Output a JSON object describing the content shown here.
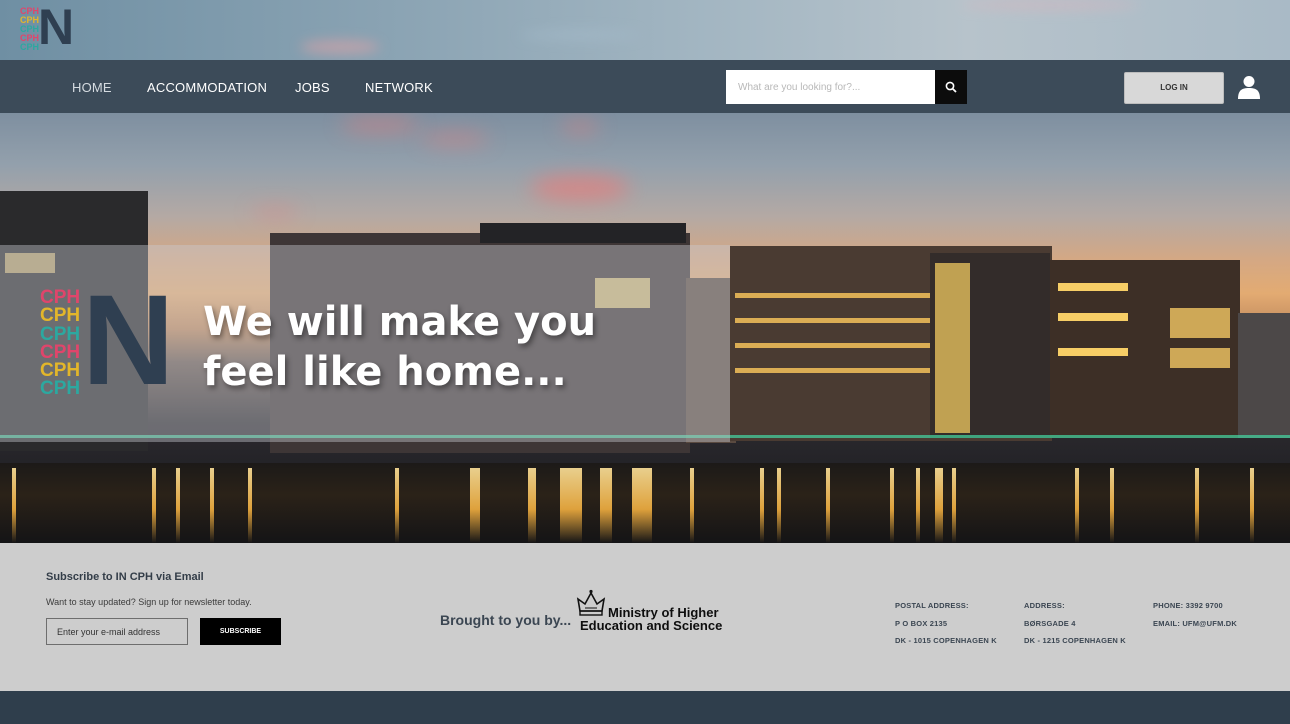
{
  "logo": {
    "stack_lines": [
      "CPH",
      "CPH",
      "CPH",
      "CPH",
      "CPH",
      "CPH"
    ],
    "stack_colors": [
      "#e0456b",
      "#e3b62a",
      "#2ca8a0",
      "#e0456b",
      "#e3b62a",
      "#2ca8a0"
    ],
    "letter": "N"
  },
  "nav": {
    "items": [
      {
        "label": "HOME"
      },
      {
        "label": "ACCOMMODATION"
      },
      {
        "label": "JOBS"
      },
      {
        "label": "NETWORK"
      }
    ],
    "search_placeholder": "What are you looking for?...",
    "login_label": "LOG IN"
  },
  "hero": {
    "line1": "We will make you",
    "line2": "feel like home..."
  },
  "footer": {
    "subscribe_title": "Subscribe to IN CPH via Email",
    "subscribe_desc": "Want to stay updated? Sign up for newsletter today.",
    "email_placeholder": "Enter your e-mail address",
    "subscribe_label": "SUBSCRIBE",
    "brought_by": "Brought to you by...",
    "ministry_line1": "Ministry of Higher",
    "ministry_line2": "Education and Science",
    "postal_label": "POSTAL ADDRESS:",
    "postal_line1": "P O BOX 2135",
    "postal_line2": "DK - 1015 COPENHAGEN K",
    "address_label": "ADDRESS:",
    "address_line1": "BØRSGADE 4",
    "address_line2": "DK - 1215 COPENHAGEN K",
    "phone": "PHONE: 3392 9700",
    "email": "EMAIL: UFM@UFM.DK"
  },
  "colors": {
    "nav_bg": "#3c4b59",
    "footer_bg": "#cdcdcd",
    "logo_n": "#2f3f51"
  }
}
